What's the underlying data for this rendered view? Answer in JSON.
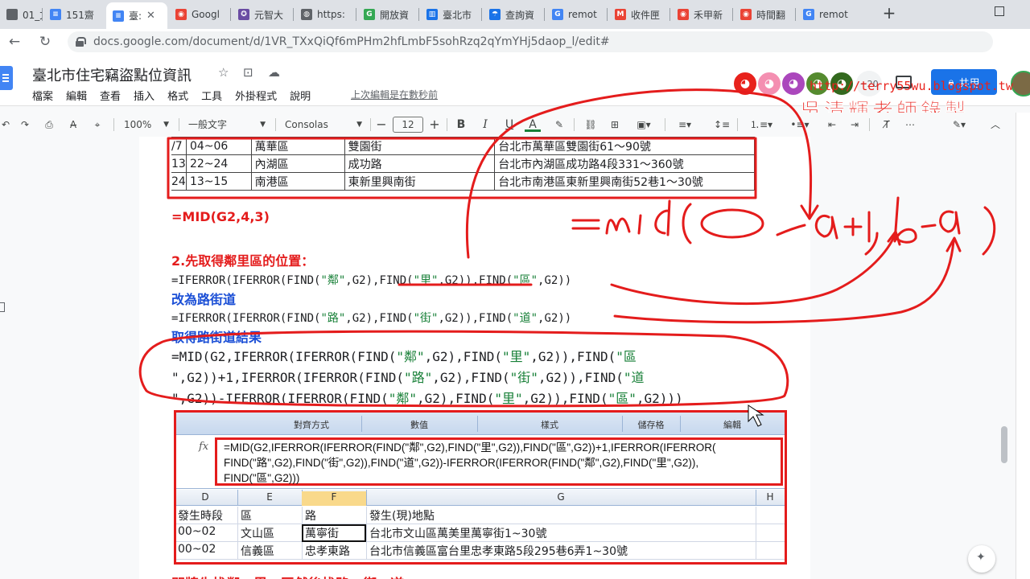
{
  "browser": {
    "tabs": [
      {
        "label": "01_文",
        "color": "#5f6368",
        "glyph": ""
      },
      {
        "label": "151齋",
        "color": "#4285f4",
        "glyph": "≡"
      },
      {
        "label": "臺:",
        "color": "#4285f4",
        "glyph": "≡",
        "active": true
      },
      {
        "label": "Googl",
        "color": "#ea4335",
        "glyph": "◉"
      },
      {
        "label": "元智大",
        "color": "#6a4ca3",
        "glyph": "✪"
      },
      {
        "label": "https:",
        "color": "#5f6368",
        "glyph": "◍"
      },
      {
        "label": "開放資",
        "color": "#34a853",
        "glyph": "G"
      },
      {
        "label": "臺北市",
        "color": "#1a73e8",
        "glyph": "▥"
      },
      {
        "label": "查詢資",
        "color": "#1a73e8",
        "glyph": "☂"
      },
      {
        "label": "remot",
        "color": "#4285f4",
        "glyph": "G"
      },
      {
        "label": "收件匣",
        "color": "#ea4335",
        "glyph": "M"
      },
      {
        "label": "禾甲新",
        "color": "#ea4335",
        "glyph": "◉"
      },
      {
        "label": "時間翻",
        "color": "#ea4335",
        "glyph": "◉"
      },
      {
        "label": "remot",
        "color": "#4285f4",
        "glyph": "G"
      }
    ],
    "new_tab": "+",
    "url": "docs.google.com/document/d/1VR_TXxQiQf6mPHm2hfLmbF5sohRzq2qYmYHj5daop_l/edit#"
  },
  "docs": {
    "title": "臺北市住宅竊盜點位資訊",
    "menus": [
      "檔案",
      "編輯",
      "查看",
      "插入",
      "格式",
      "工具",
      "外掛程式",
      "說明"
    ],
    "last_edit": "上次編輯是在數秒前",
    "avatars_more": "+20",
    "share_label": "共用",
    "avatar_colors": [
      "#e8221c",
      "#f48fb1",
      "#ab47bc",
      "#558b2f",
      "#33691e"
    ]
  },
  "watermark": {
    "url": "http://terry55wu.blogspot.tw",
    "author": "吳清輝老師錄製"
  },
  "toolbar": {
    "zoom": "100%",
    "style": "一般文字",
    "font": "Consolas",
    "size": "12"
  },
  "doc": {
    "table_rows": [
      [
        "/7",
        "04~06",
        "萬華區",
        "雙園街",
        "台北市萬華區雙園街61～90號"
      ],
      [
        "13",
        "22~24",
        "內湖區",
        "成功路",
        "台北市內湖區成功路4段331～360號"
      ],
      [
        "24",
        "13~15",
        "南港區",
        "東新里興南街",
        "台北市南港區東新里興南街52巷1～30號"
      ]
    ],
    "formula_example": "=MID(G2,4,3)",
    "step2_heading": "2.先取得鄰里區的位置：",
    "step2_formula": {
      "p1": "=IFERROR(IFERROR(FIND(",
      "q1": "\"鄰\"",
      "p2": ",G2),FIND(",
      "q2": "\"里\"",
      "p3": ",G2)),FIND(",
      "q3": "\"區\"",
      "p4": ",G2))"
    },
    "road_heading": "改為路街道",
    "road_formula": {
      "p1": "=IFERROR(IFERROR(FIND(",
      "q1": "\"路\"",
      "p2": ",G2),FIND(",
      "q2": "\"街\"",
      "p3": ",G2)),FIND(",
      "q3": "\"道\"",
      "p4": ",G2))"
    },
    "result_heading": "取得路街道結果",
    "result_lines": [
      {
        "a": "=MID(G2,IFERROR(IFERROR(FIND(",
        "q1": "\"鄰\"",
        "b": ",G2),FIND(",
        "q2": "\"里\"",
        "c": ",G2)),FIND(",
        "q3": "\"區",
        "d": ""
      },
      {
        "a": "\",G2))+1,IFERROR(IFERROR(FIND(",
        "q1": "\"路\"",
        "b": ",G2),FIND(",
        "q2": "\"街\"",
        "c": ",G2)),FIND(",
        "q3": "\"道",
        "d": ""
      },
      {
        "a": "\",G2))-IFERROR(IFERROR(FIND(",
        "q1": "\"鄰\"",
        "b": ",G2),FIND(",
        "q2": "\"里\"",
        "c": ",G2)),FIND(",
        "q3": "\"區\"",
        "d": ",G2)))"
      }
    ],
    "cutoff_text": "門牌先找鄰、里、區然後找路、街、道"
  },
  "excel": {
    "ribbon_groups": [
      "對齊方式",
      "數值",
      "樣式",
      "儲存格",
      "編輯"
    ],
    "fx_symbol": "fx",
    "formula_lines": [
      "=MID(G2,IFERROR(IFERROR(FIND(\"鄰\",G2),FIND(\"里\",G2)),FIND(\"區\",G2))+1,IFERROR(IFERROR(",
      "FIND(\"路\",G2),FIND(\"街\",G2)),FIND(\"道\",G2))-IFERROR(IFERROR(FIND(\"鄰\",G2),FIND(\"里\",G2)),",
      "FIND(\"區\",G2)))"
    ],
    "columns": [
      "D",
      "E",
      "F",
      "G",
      "H"
    ],
    "header_row": [
      "發生時段",
      "區",
      "路",
      "發生(現)地點"
    ],
    "rows": [
      [
        "00~02",
        "文山區",
        "萬寧街",
        "台北市文山區萬美里萬寧街1~30號"
      ],
      [
        "00~02",
        "信義區",
        "忠孝東路",
        "台北市信義區富台里忠孝東路5段295巷6弄1~30號"
      ]
    ]
  }
}
